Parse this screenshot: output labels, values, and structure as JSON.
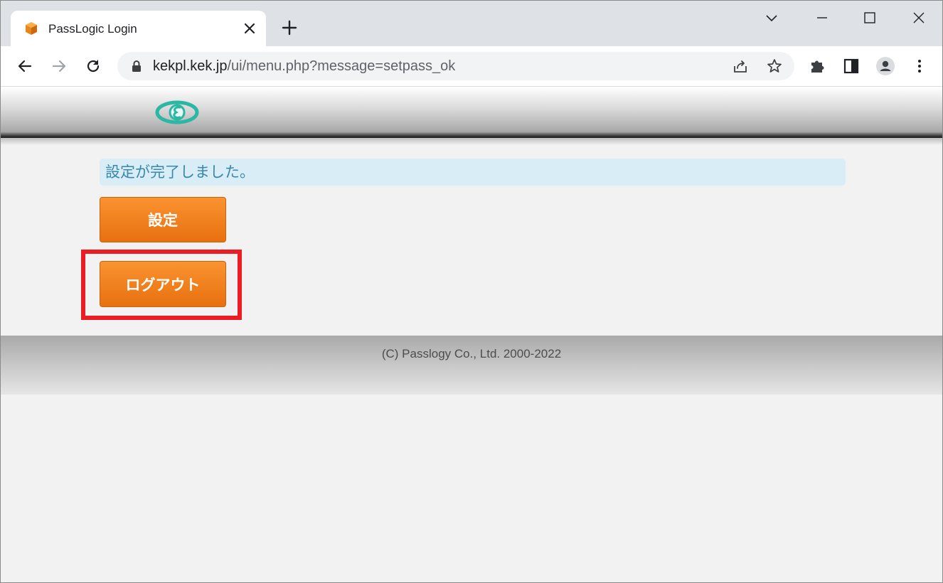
{
  "browser": {
    "tab_title": "PassLogic Login",
    "url_host": "kekpl.kek.jp",
    "url_path": "/ui/menu.php?message=setpass_ok",
    "icons": [
      "back-icon",
      "forward-icon",
      "reload-icon",
      "lock-icon",
      "share-icon",
      "star-icon",
      "extensions-icon",
      "side-panel-icon",
      "profile-icon",
      "menu-icon",
      "tab-search-icon",
      "minimize-icon",
      "maximize-icon",
      "close-window-icon",
      "new-tab-icon",
      "tab-close-icon"
    ]
  },
  "page": {
    "message": "設定が完了しました。",
    "settings_button": "設定",
    "logout_button": "ログアウト",
    "footer": "(C) Passlogy Co., Ltd. 2000-2022"
  },
  "colors": {
    "accent_orange": "#f18a24",
    "message_bg": "#d9edf7",
    "message_text": "#3a87ad",
    "highlight": "#ec1c24",
    "logo": "#2bb7a3"
  }
}
